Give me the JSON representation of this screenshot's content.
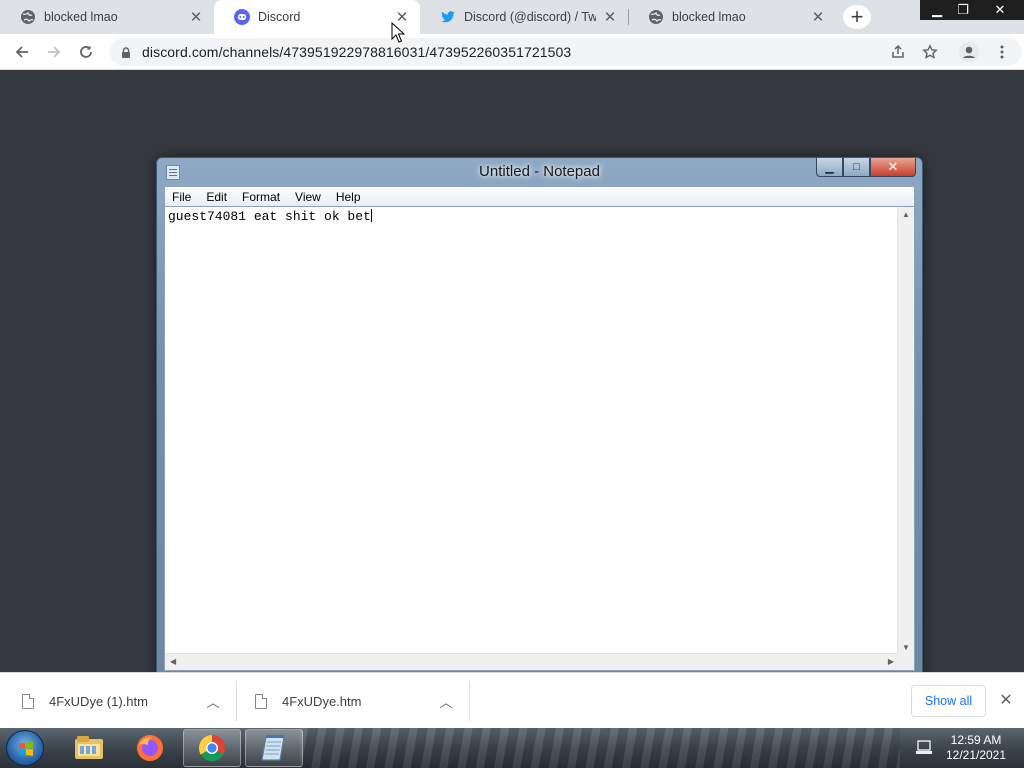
{
  "browser": {
    "tabs": [
      {
        "label": "blocked lmao",
        "icon": "globe-icon",
        "active": false
      },
      {
        "label": "Discord",
        "icon": "discord-icon",
        "active": true
      },
      {
        "label": "Discord (@discord) / Twitte",
        "icon": "twitter-icon",
        "active": false
      },
      {
        "label": "blocked lmao",
        "icon": "globe-icon",
        "active": false
      }
    ],
    "new_tab_label": "+",
    "url": "discord.com/channels/473951922978816031/473952260351721503"
  },
  "notepad": {
    "title": "Untitled - Notepad",
    "menus": [
      "File",
      "Edit",
      "Format",
      "View",
      "Help"
    ],
    "content": "guest74081 eat shit ok bet"
  },
  "downloads": {
    "items": [
      {
        "filename": "4FxUDye (1).htm"
      },
      {
        "filename": "4FxUDye.htm"
      }
    ],
    "show_all_label": "Show all"
  },
  "taskbar": {
    "time": "12:59 AM",
    "date": "12/21/2021",
    "pinned": [
      "explorer-icon",
      "firefox-icon",
      "chrome-icon",
      "notepad-icon"
    ]
  },
  "colors": {
    "page_background": "#36393f",
    "accent_blue": "#1a73e8"
  }
}
